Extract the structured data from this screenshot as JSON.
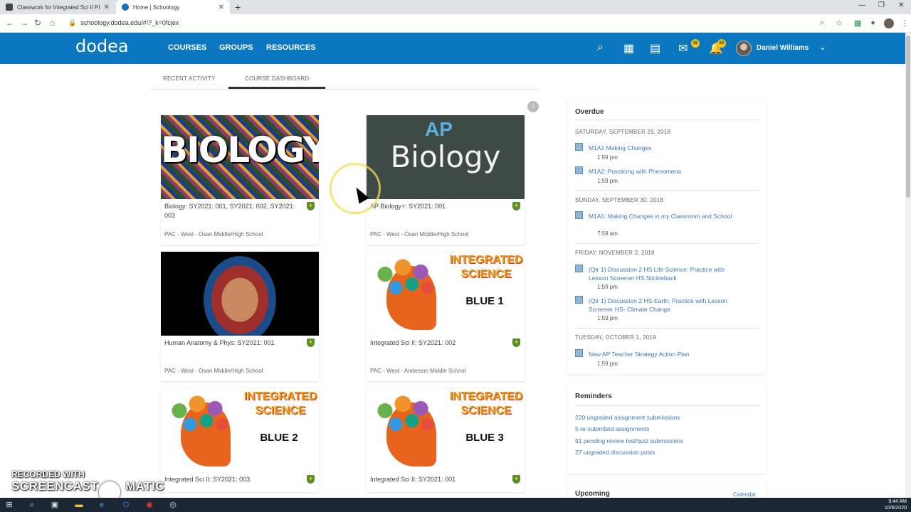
{
  "browser": {
    "tabs": [
      {
        "title": "Classwork for Integrated Sci II PI"
      },
      {
        "title": "Home | Schoology"
      }
    ],
    "url": "schoology.dodea.edu/#/?_k=0fcjex"
  },
  "header": {
    "logo_text": "dodea",
    "nav": [
      "COURSES",
      "GROUPS",
      "RESOURCES"
    ],
    "mail_badge": "38",
    "notif_badge": "50",
    "username": "Daniel Williams"
  },
  "subtabs": [
    "RECENT ACTIVITY",
    "COURSE DASHBOARD"
  ],
  "courses": [
    {
      "title": "Biology: SY2021: 001, SY2021: 002, SY2021: 003",
      "school": "PAC - West - Osan Middle/High School",
      "image_text": "BIOLOGY"
    },
    {
      "title": "AP Biology+: SY2021: 001",
      "school": "PAC - West - Osan Middle/High School",
      "image_text": "Biology",
      "image_text2": "AP"
    },
    {
      "title": "Human Anatomy & Phys: SY2021: 001",
      "school": "PAC - West - Osan Middle/High School"
    },
    {
      "title": "Integrated Sci II: SY2021: 002",
      "school": "PAC - West - Anderson Middle School",
      "image_header": "INTEGRATED SCIENCE",
      "image_level": "BLUE 1"
    },
    {
      "title": "Integrated Sci II: SY2021: 003",
      "school": "",
      "image_header": "INTEGRATED SCIENCE",
      "image_level": "BLUE 2"
    },
    {
      "title": "Integrated Sci II: SY2021: 001",
      "school": "",
      "image_header": "INTEGRATED SCIENCE",
      "image_level": "BLUE 3"
    }
  ],
  "overdue": {
    "title": "Overdue",
    "groups": [
      {
        "date": "SATURDAY, SEPTEMBER 29, 2018",
        "items": [
          {
            "name": "M1A1 Making Changes",
            "time": "1:59 pm"
          },
          {
            "name": "M1A2: Practicing with Phenomena",
            "time": "1:59 pm"
          }
        ]
      },
      {
        "date": "SUNDAY, SEPTEMBER 30, 2018",
        "items": [
          {
            "name": "M1A1: Making Changes in my Classroom and School",
            "time": "7:59 am"
          }
        ]
      },
      {
        "date": "FRIDAY, NOVEMBER 2, 2018",
        "items": [
          {
            "name": "(Qtr 1) Discussion 2 HS Life Science: Practice with Lesson Screener HS Stickleback",
            "time": "1:59 pm"
          },
          {
            "name": "(Qtr 1) Discussion 2 HS-Earth: Practice with Lesson Screener HS- Climate Change",
            "time": "1:59 pm"
          }
        ]
      },
      {
        "date": "TUESDAY, OCTOBER 1, 2019",
        "items": [
          {
            "name": "New AP Teacher Strategy Action Plan",
            "time": "1:59 pm"
          }
        ]
      }
    ]
  },
  "reminders": {
    "title": "Reminders",
    "items": [
      "220 ungraded assignment submissions",
      "5 re-submitted assignments",
      "91 pending review test/quiz submissions",
      "27 ungraded discussion posts"
    ]
  },
  "upcoming": {
    "title": "Upcoming",
    "link": "Calendar"
  },
  "watermark": {
    "line1": "RECORDED WITH",
    "line2": "SCREENCAST",
    "line3": "MATIC"
  },
  "taskbar": {
    "time": "9:44 AM",
    "date": "10/6/2020"
  }
}
